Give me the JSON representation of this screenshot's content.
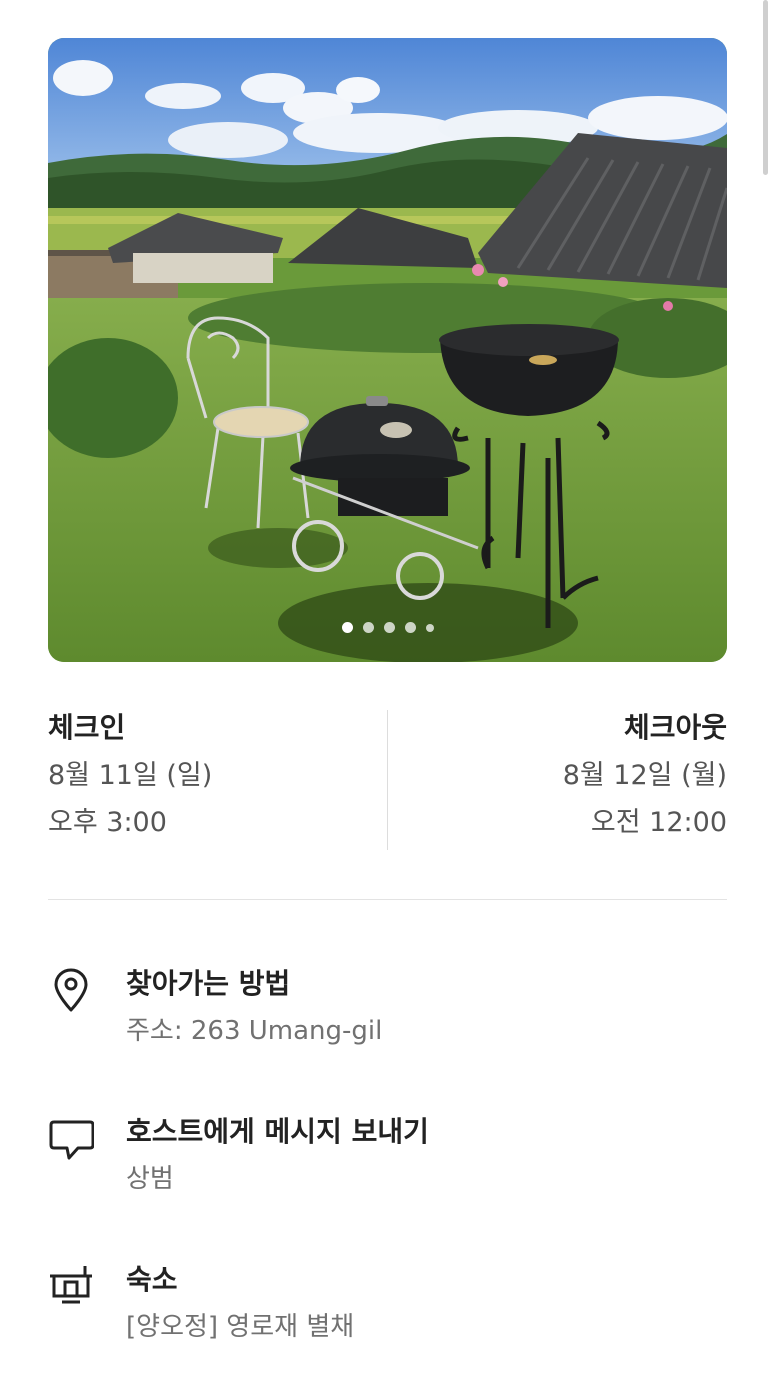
{
  "listing_photo": {
    "alt": "",
    "page_count": 5,
    "current_page": 1
  },
  "check_in": {
    "label": "체크인",
    "date": "8월 11일 (일)",
    "time": "오후 3:00"
  },
  "check_out": {
    "label": "체크아웃",
    "date": "8월 12일 (월)",
    "time": "오전 12:00"
  },
  "directions": {
    "icon": "location-pin-icon",
    "title": "찾아가는 방법",
    "subtitle": "주소: 263 Umang-gil"
  },
  "message_host": {
    "icon": "chat-bubble-icon",
    "title": "호스트에게 메시지 보내기",
    "subtitle": "상범"
  },
  "accommodation": {
    "icon": "house-icon",
    "title": "숙소",
    "subtitle": "[양오정] 영로재 별채"
  },
  "colors": {
    "text_primary": "#222222",
    "text_secondary": "#717171",
    "divider": "#dddddd"
  }
}
